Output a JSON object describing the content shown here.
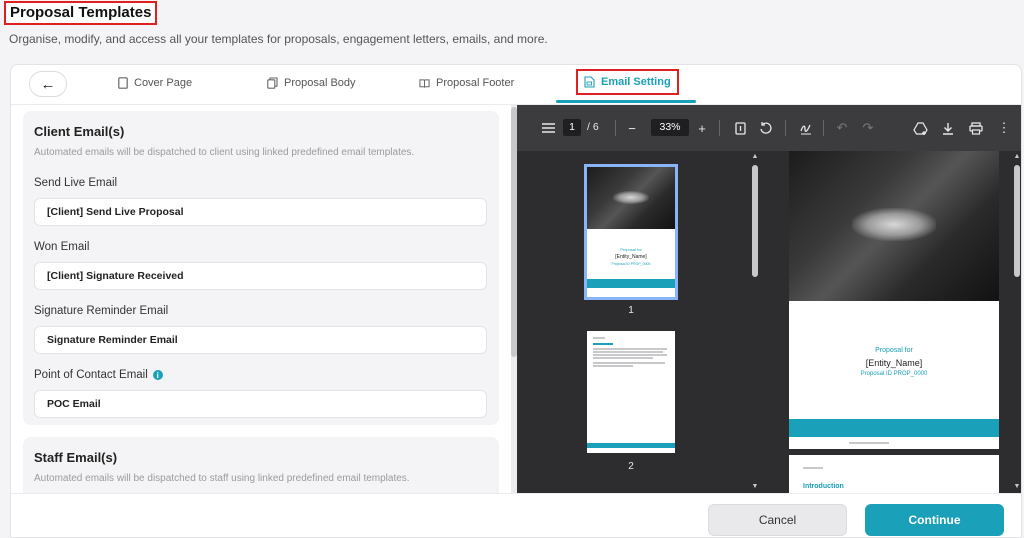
{
  "header": {
    "title": "Proposal Templates",
    "subtitle": "Organise, modify, and access all your templates for proposals, engagement letters, emails, and more."
  },
  "tabs": [
    {
      "label": "Cover Page",
      "icon": "page-icon"
    },
    {
      "label": "Proposal Body",
      "icon": "copy-icon"
    },
    {
      "label": "Proposal Footer",
      "icon": "book-icon"
    },
    {
      "label": "Email Setting",
      "icon": "file-mail-icon",
      "active": true
    }
  ],
  "client_section": {
    "title": "Client Email(s)",
    "description": "Automated emails will be dispatched to client using linked predefined email templates.",
    "fields": [
      {
        "label": "Send Live Email",
        "value": "[Client] Send Live Proposal"
      },
      {
        "label": "Won Email",
        "value": "[Client] Signature Received"
      },
      {
        "label": "Signature Reminder Email",
        "value": "Signature Reminder Email"
      },
      {
        "label": "Point of Contact Email",
        "value": "POC Email"
      }
    ]
  },
  "staff_section": {
    "title": "Staff Email(s)",
    "description": "Automated emails will be dispatched to staff using linked predefined email templates."
  },
  "viewer": {
    "current_page": "1",
    "page_total": "/ 6",
    "zoom": "33%",
    "thumb_labels": [
      "1",
      "2"
    ],
    "proposal_for": "Proposal for",
    "entity_name": "[Entity_Name]",
    "proposal_id": "Proposal ID PROP_0000",
    "page2_heading": "Introduction"
  },
  "footer": {
    "cancel_label": "Cancel",
    "continue_label": "Continue"
  },
  "colors": {
    "accent": "#1aa0b8",
    "highlight_border": "#e02020"
  }
}
